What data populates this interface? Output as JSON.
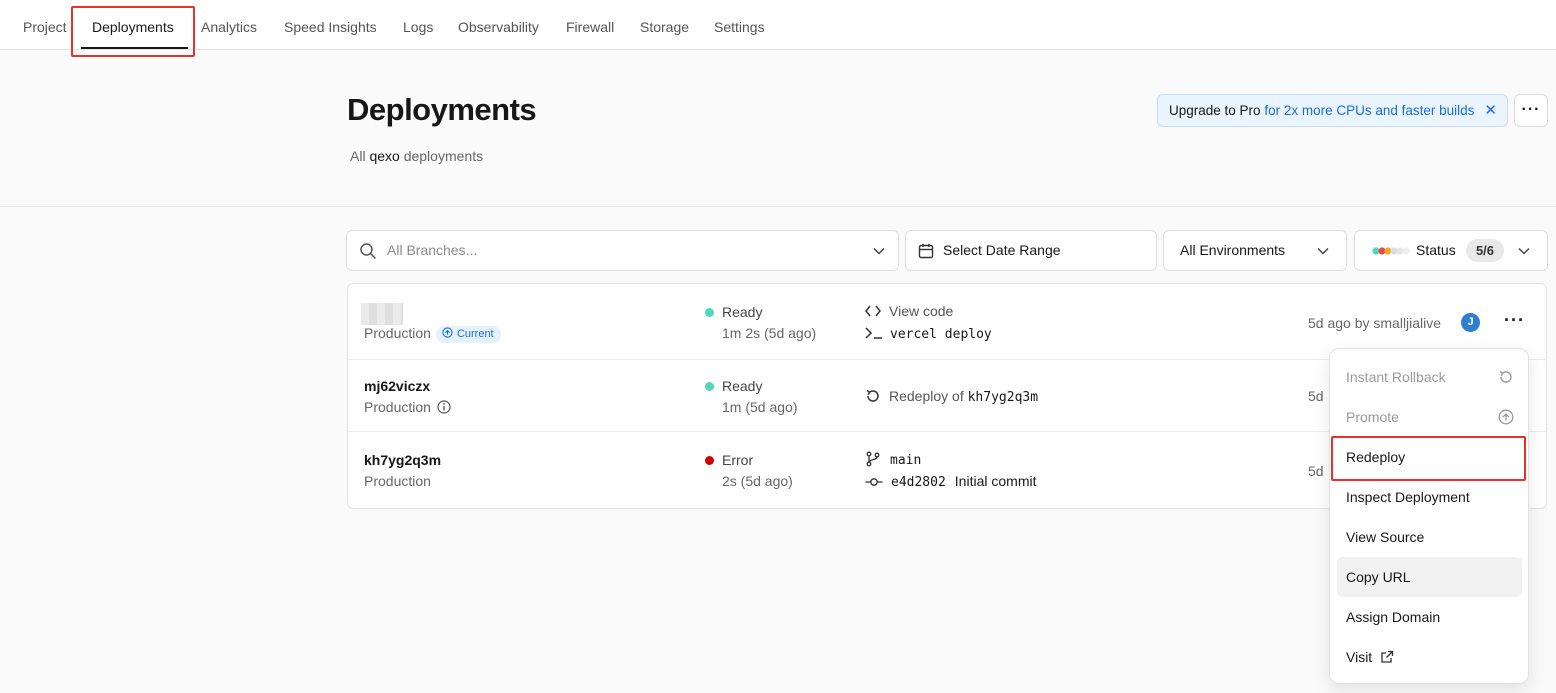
{
  "nav": {
    "tabs": [
      "Project",
      "Deployments",
      "Analytics",
      "Speed Insights",
      "Logs",
      "Observability",
      "Firewall",
      "Storage",
      "Settings"
    ],
    "active": "Deployments"
  },
  "header": {
    "title": "Deployments",
    "subtitle_prefix": "All ",
    "project": "qexo",
    "subtitle_suffix": " deployments"
  },
  "upgrade_banner": {
    "strong": "Upgrade to Pro",
    "link": " for 2x more CPUs and faster builds"
  },
  "filters": {
    "branch_placeholder": "All Branches...",
    "date": "Select Date Range",
    "environment": "All Environments",
    "status_label": "Status",
    "status_count": "5/6"
  },
  "deployments": [
    {
      "id": "",
      "environment": "Production",
      "current_badge": "Current",
      "status": "Ready",
      "status_color": "#50d6b8",
      "duration": "1m 2s (5d ago)",
      "source_line1": "View code",
      "source_line2": "vercel deploy",
      "meta": "5d ago by smalljialive",
      "avatar": "J"
    },
    {
      "id": "mj62viczx",
      "environment": "Production",
      "status": "Ready",
      "status_color": "#50d6b8",
      "duration": "1m (5d ago)",
      "source_label": "Redeploy of",
      "source_ref": "kh7yg2q3m",
      "meta": "5d"
    },
    {
      "id": "kh7yg2q3m",
      "environment": "Production",
      "status": "Error",
      "status_color": "#d40000",
      "duration": "2s (5d ago)",
      "branch": "main",
      "commit": "e4d2802",
      "commit_message": "Initial commit",
      "meta": "5d"
    }
  ],
  "row_menu": {
    "items": [
      {
        "label": "Instant Rollback",
        "disabled": true,
        "icon": "rollback-icon"
      },
      {
        "label": "Promote",
        "disabled": true,
        "icon": "arrow-up-circle-icon"
      },
      {
        "label": "Redeploy",
        "disabled": false
      },
      {
        "label": "Inspect Deployment",
        "disabled": false
      },
      {
        "label": "View Source",
        "disabled": false
      },
      {
        "label": "Copy URL",
        "disabled": false,
        "hover": true
      },
      {
        "label": "Assign Domain",
        "disabled": false
      },
      {
        "label": "Visit",
        "disabled": false,
        "icon": "external-link-icon"
      }
    ]
  },
  "colors": {
    "annotation": "#e5322d",
    "accent_blue": "#1a6ed8",
    "ready": "#50d6b8",
    "error": "#d40000"
  }
}
